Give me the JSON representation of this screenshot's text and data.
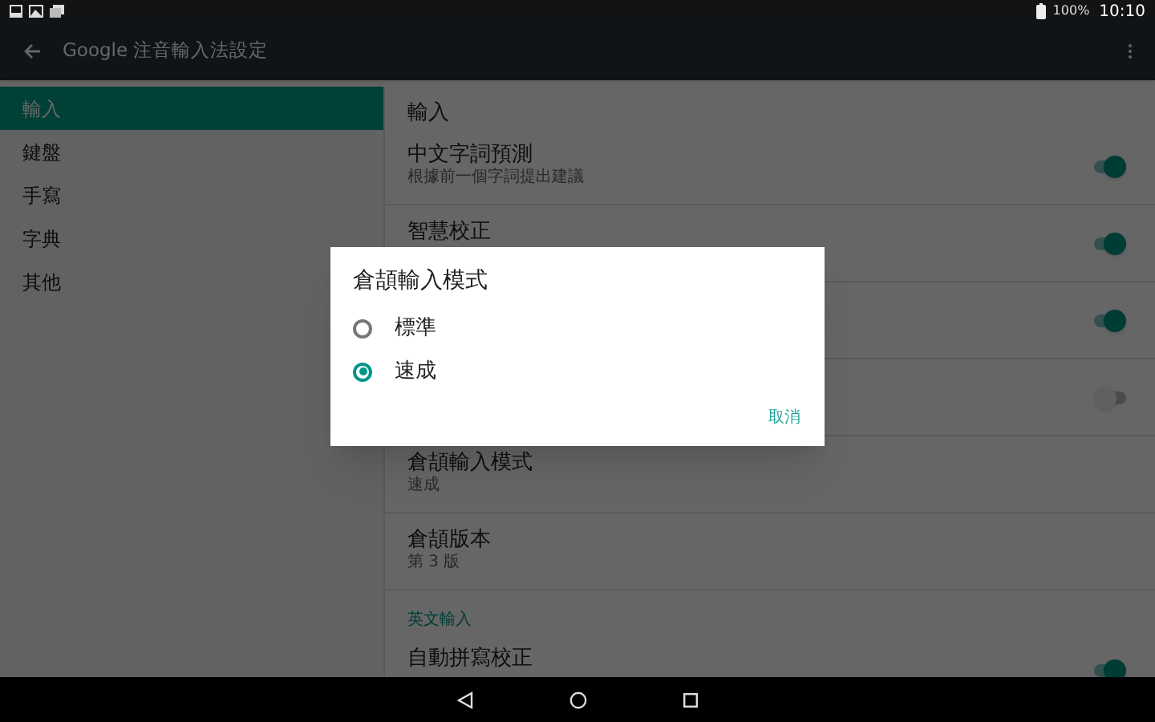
{
  "status_bar": {
    "battery": "100%",
    "time": "10:10"
  },
  "toolbar": {
    "title": "Google 注音輸入法設定"
  },
  "sidebar": {
    "items": [
      {
        "label": "輸入",
        "selected": true
      },
      {
        "label": "鍵盤",
        "selected": false
      },
      {
        "label": "手寫",
        "selected": false
      },
      {
        "label": "字典",
        "selected": false
      },
      {
        "label": "其他",
        "selected": false
      }
    ]
  },
  "content": {
    "items": [
      {
        "kind": "header",
        "title": "輸入"
      },
      {
        "kind": "switch",
        "title": "中文字詞預測",
        "subtitle": "根據前一個字詞提出建議",
        "on": true
      },
      {
        "kind": "switch",
        "title": "智慧校正",
        "on": true
      },
      {
        "kind": "switch",
        "on": true
      },
      {
        "kind": "switch",
        "on": false
      },
      {
        "kind": "text",
        "title": "倉頡輸入模式",
        "subtitle": "速成"
      },
      {
        "kind": "text",
        "title": "倉頡版本",
        "subtitle": "第 3 版"
      },
      {
        "kind": "section",
        "title": "英文輸入"
      },
      {
        "kind": "switch",
        "title": "自動拼寫校正",
        "on": true
      }
    ]
  },
  "dialog": {
    "title": "倉頡輸入模式",
    "options": [
      {
        "label": "標準",
        "selected": false
      },
      {
        "label": "速成",
        "selected": true
      }
    ],
    "buttons": [
      "取消"
    ]
  }
}
